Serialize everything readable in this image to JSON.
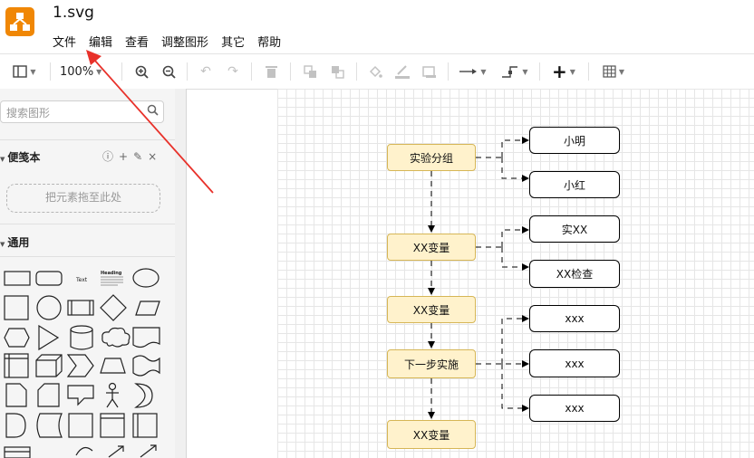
{
  "app": {
    "title": "1.svg",
    "accent": "#f08705"
  },
  "menu": [
    "文件",
    "编辑",
    "查看",
    "调整图形",
    "其它",
    "帮助"
  ],
  "toolbar": {
    "zoom": "100%"
  },
  "sidebar": {
    "search_placeholder": "搜索图形",
    "scratchpad_title": "便笺本",
    "drop_hint": "把元素拖至此处",
    "general_title": "通用",
    "text_shape": "Text",
    "heading_shape": "Heading"
  },
  "diagram": {
    "nodes": {
      "group": "实验分组",
      "var1": "XX变量",
      "var2": "XX变量",
      "next": "下一步实施",
      "var3": "XX变量",
      "xiaoming": "小明",
      "xiaohong": "小红",
      "shixx": "实XX",
      "check": "XX检查",
      "x1": "xxx",
      "x2": "xxx",
      "x3": "xxx"
    }
  },
  "annotation": {
    "arrow_color": "#e8312a"
  }
}
